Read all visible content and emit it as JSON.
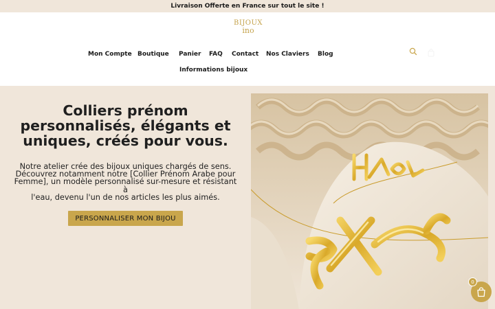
{
  "announcement": {
    "text": "Livraison Offerte en France sur tout le site !"
  },
  "logo": {
    "line1": "BIJOUX",
    "line2": "ino"
  },
  "nav": {
    "items": [
      {
        "label": "Mon Compte"
      },
      {
        "label": "Boutique"
      },
      {
        "label": "Panier"
      },
      {
        "label": "FAQ"
      },
      {
        "label": "Contact"
      },
      {
        "label": "Nos Claviers"
      },
      {
        "label": "Blog"
      },
      {
        "label": "Informations bijoux"
      }
    ]
  },
  "header_icons": {
    "search": "search-icon",
    "cart": "cart-icon"
  },
  "hero": {
    "headline_lines": [
      "Colliers prénom",
      "personnalisés, élégants et",
      "uniques, créés pour vous."
    ],
    "description_lines": [
      "Notre atelier crée des bijoux uniques chargés de sens.",
      "Découvrez notamment notre [Collier Prénom Arabe pour",
      "Femme], un modèle personnalisé sur-mesure et résistant à",
      "l'eau, devenu l'un de nos articles les plus aimés."
    ],
    "cta_label": "PERSONNALISER MON BIJOU"
  },
  "floating_cart": {
    "count": "0",
    "icon": "shopping-bag-icon"
  },
  "colors": {
    "accent": "#c9a64c",
    "page_bg": "#f0e6da",
    "header_bg": "#ffffff",
    "text": "#1f1f1f"
  }
}
